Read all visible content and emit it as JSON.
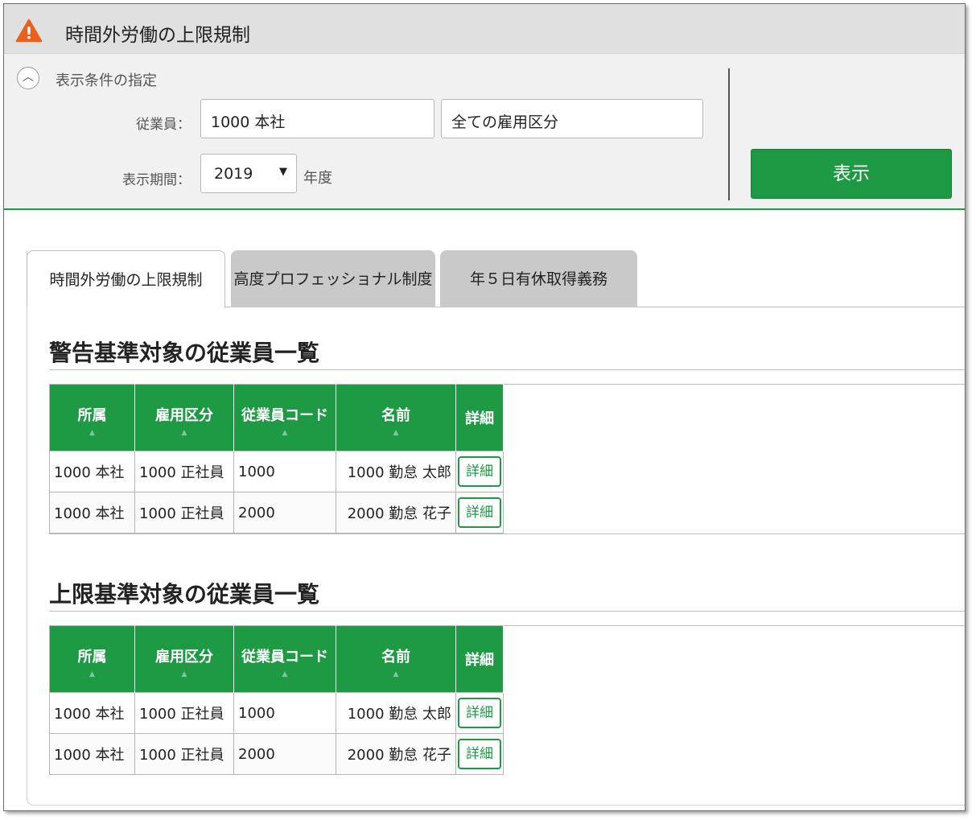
{
  "window": {
    "title": "時間外労働の上限規制",
    "icon": "warning-triangle-icon"
  },
  "conditions": {
    "caption": "表示条件の指定",
    "employee_label": "従業員：",
    "employee_value": "1000 本社",
    "employment_class_value": "全ての雇用区分",
    "period_label": "表示期間：",
    "year_value": "2019",
    "year_unit": "年度",
    "show_button": "表示"
  },
  "tabs": [
    {
      "label": "時間外労働の上限規制",
      "active": true
    },
    {
      "label": "高度プロフェッショナル制度",
      "active": false
    },
    {
      "label": "年５日有休取得義務",
      "active": false
    }
  ],
  "columns": {
    "dept": "所属",
    "class": "雇用区分",
    "code": "従業員コード",
    "name": "名前",
    "detail": "詳細"
  },
  "sections": [
    {
      "title": "警告基準対象の従業員一覧",
      "rows": [
        {
          "dept": "1000 本社",
          "class": "1000 正社員",
          "code": "1000",
          "name": "1000 勤怠 太郎",
          "detail": "詳細"
        },
        {
          "dept": "1000 本社",
          "class": "1000 正社員",
          "code": "2000",
          "name": "2000 勤怠 花子",
          "detail": "詳細"
        }
      ]
    },
    {
      "title": "上限基準対象の従業員一覧",
      "rows": [
        {
          "dept": "1000 本社",
          "class": "1000 正社員",
          "code": "1000",
          "name": "1000 勤怠 太郎",
          "detail": "詳細"
        },
        {
          "dept": "1000 本社",
          "class": "1000 正社員",
          "code": "2000",
          "name": "2000 勤怠 花子",
          "detail": "詳細"
        }
      ]
    }
  ],
  "colors": {
    "accent": "#1e9a45",
    "warning": "#e8601c",
    "titlebar": "#e0e0e0",
    "panel": "#f1f1f1",
    "inactive_tab": "#c9c9c9"
  }
}
